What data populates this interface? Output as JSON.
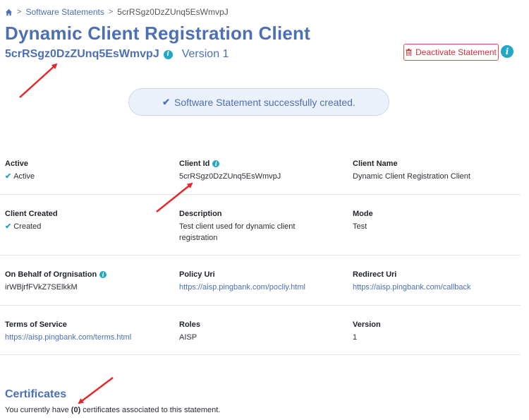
{
  "breadcrumb": {
    "home_icon": "home-icon",
    "parent": "Software Statements",
    "separator": ">",
    "current": "5crRSgz0DzZUnq5EsWmvpJ"
  },
  "header": {
    "title": "Dynamic Client Registration Client",
    "client_id": "5crRSgz0DzZUnq5EsWmvpJ",
    "version": "Version 1",
    "deactivate_label": "Deactivate Statement"
  },
  "banner": {
    "message": "Software Statement successfully created."
  },
  "details": {
    "active": {
      "label": "Active",
      "value": "Active"
    },
    "client_id": {
      "label": "Client Id",
      "value": "5crRSgz0DzZUnq5EsWmvpJ"
    },
    "client_name": {
      "label": "Client Name",
      "value": "Dynamic Client Registration Client"
    },
    "client_created": {
      "label": "Client Created",
      "value": "Created"
    },
    "description": {
      "label": "Description",
      "value": "Test client used for dynamic client registration"
    },
    "mode": {
      "label": "Mode",
      "value": "Test"
    },
    "on_behalf": {
      "label": "On Behalf of Orgnisation",
      "value": "irWBjrfFVkZ7SElkkM"
    },
    "policy_uri": {
      "label": "Policy Uri",
      "value": "https://aisp.pingbank.com/pocliy.html"
    },
    "redirect_uri": {
      "label": "Redirect Uri",
      "value": "https://aisp.pingbank.com/callback"
    },
    "terms": {
      "label": "Terms of Service",
      "value": "https://aisp.pingbank.com/terms.html"
    },
    "roles": {
      "label": "Roles",
      "value": "AISP"
    },
    "version": {
      "label": "Version",
      "value": "1"
    }
  },
  "certificates": {
    "title": "Certificates",
    "text_before": "You currently have",
    "count": "(0)",
    "text_after": "certificates associated to this statement."
  },
  "colors": {
    "brand_blue": "#4c6fb5",
    "info_teal": "#24a6c7",
    "danger_red": "#c7343e",
    "annotation_red": "#e8272b"
  }
}
